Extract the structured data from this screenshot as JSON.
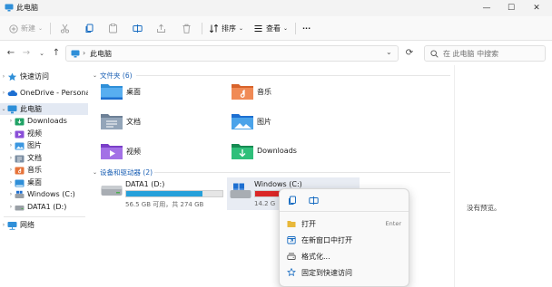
{
  "window": {
    "title": "此电脑",
    "min_glyph": "—",
    "max_glyph": "☐",
    "close_glyph": "✕"
  },
  "toolbar": {
    "new_label": "新建",
    "sort_label": "排序",
    "view_label": "查看",
    "more_glyph": "···"
  },
  "address": {
    "location": "此电脑",
    "chevron": "›",
    "search_placeholder": "在 此电脑 中搜索"
  },
  "sidebar": {
    "items": [
      {
        "label": "快速访问",
        "icon": "star-icon",
        "expand": "›"
      },
      {
        "label": "OneDrive - Personal",
        "icon": "cloud-icon",
        "expand": "›"
      },
      {
        "label": "此电脑",
        "icon": "pc-icon",
        "expand": "⌄"
      },
      {
        "label": "Downloads",
        "icon": "downloads-icon",
        "expand": "›"
      },
      {
        "label": "视频",
        "icon": "videos-icon",
        "expand": "›"
      },
      {
        "label": "图片",
        "icon": "pictures-icon",
        "expand": "›"
      },
      {
        "label": "文档",
        "icon": "documents-icon",
        "expand": "›"
      },
      {
        "label": "音乐",
        "icon": "music-icon",
        "expand": "›"
      },
      {
        "label": "桌面",
        "icon": "desktop-icon",
        "expand": "›"
      },
      {
        "label": "Windows (C:)",
        "icon": "drive-c-icon",
        "expand": "›"
      },
      {
        "label": "DATA1 (D:)",
        "icon": "drive-d-icon",
        "expand": "›"
      },
      {
        "label": "网络",
        "icon": "network-icon",
        "expand": "›"
      }
    ]
  },
  "content": {
    "folders_header": "文件夹 (6)",
    "folders": [
      {
        "label": "桌面",
        "icon": "desktop-folder-icon"
      },
      {
        "label": "音乐",
        "icon": "music-folder-icon"
      },
      {
        "label": "文档",
        "icon": "documents-folder-icon"
      },
      {
        "label": "图片",
        "icon": "pictures-folder-icon"
      },
      {
        "label": "视频",
        "icon": "videos-folder-icon"
      },
      {
        "label": "Downloads",
        "icon": "downloads-folder-icon"
      }
    ],
    "drives_header": "设备和驱动器 (2)",
    "drives": [
      {
        "name": "DATA1 (D:)",
        "space": "56.5 GB 可用，共 274 GB",
        "used_fraction": 0.79,
        "fill_color": "#26a0da"
      },
      {
        "name": "Windows (C:)",
        "space": "14.2 G",
        "used_fraction": 0.5,
        "fill_color": "#da2626"
      }
    ]
  },
  "preview": {
    "empty_text": "没有预览。"
  },
  "context_menu": {
    "items": [
      {
        "label": "打开",
        "shortcut": "Enter",
        "icon": "open-folder-icon"
      },
      {
        "label": "在新窗口中打开",
        "shortcut": "",
        "icon": "new-window-icon"
      },
      {
        "label": "格式化...",
        "shortcut": "",
        "icon": "format-icon"
      },
      {
        "label": "固定到快速访问",
        "shortcut": "",
        "icon": "pin-icon"
      }
    ]
  },
  "colors": {
    "accent": "#0067c0",
    "selection": "#e3e9f3",
    "drive_fill_ok": "#26a0da",
    "drive_fill_full": "#da2626"
  }
}
